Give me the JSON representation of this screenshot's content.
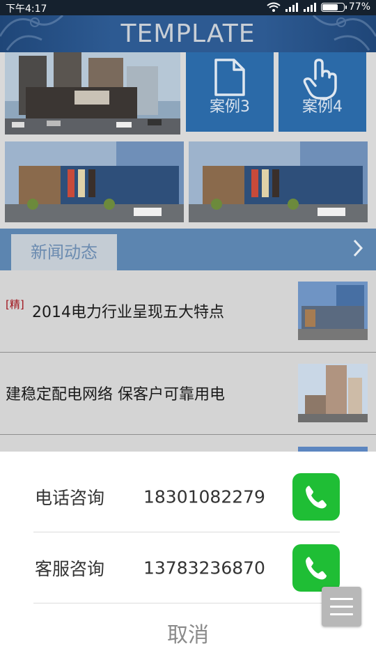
{
  "status_bar": {
    "time": "下午4:17",
    "battery": "77%",
    "battery_level": 0.77
  },
  "header": {
    "title": "TEMPLATE"
  },
  "cases": [
    {
      "label": "案例3",
      "icon": "document-icon"
    },
    {
      "label": "案例4",
      "icon": "hand-pointer-icon"
    }
  ],
  "news": {
    "tab_label": "新闻动态",
    "more_icon": "chevron-right-icon",
    "items": [
      {
        "badge": "[精]",
        "title": "2014电力行业呈现五大特点"
      },
      {
        "badge": "",
        "title": "建稳定配电网络 保客户可靠用电"
      }
    ]
  },
  "contact_sheet": {
    "rows": [
      {
        "label": "电话咨询",
        "number": "18301082279"
      },
      {
        "label": "客服咨询",
        "number": "13783236870"
      }
    ],
    "cancel_label": "取消"
  },
  "colors": {
    "header_blue": "#2d5a92",
    "tile_blue": "#2b6aa8",
    "call_green": "#1fbe35"
  }
}
